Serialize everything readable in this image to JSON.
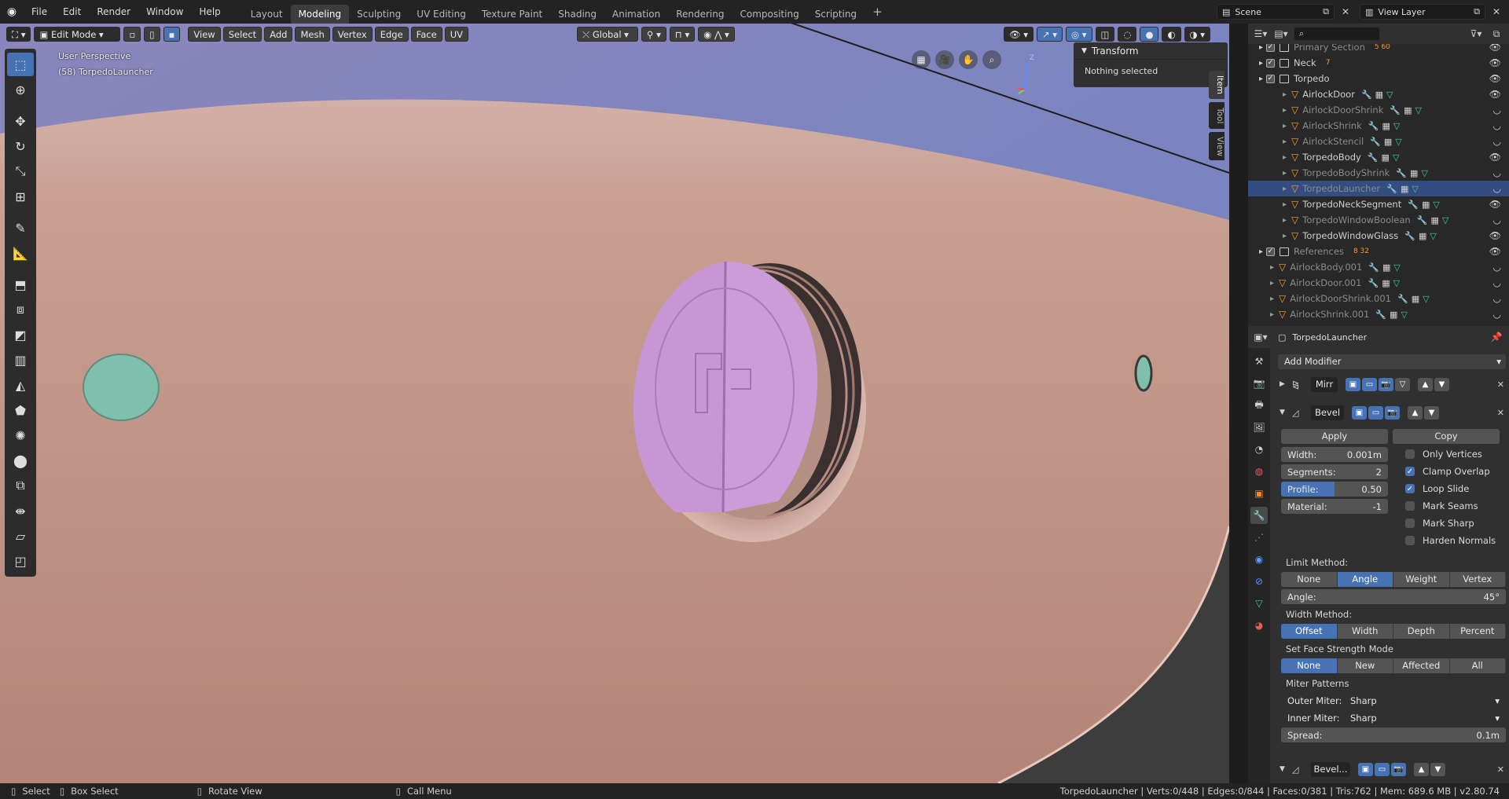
{
  "topbar": {
    "menus": [
      "File",
      "Edit",
      "Render",
      "Window",
      "Help"
    ],
    "workspaces": [
      "Layout",
      "Modeling",
      "Sculpting",
      "UV Editing",
      "Texture Paint",
      "Shading",
      "Animation",
      "Rendering",
      "Compositing",
      "Scripting"
    ],
    "active_workspace": "Modeling",
    "add_tab": "+",
    "scene": "Scene",
    "view_layer": "View Layer"
  },
  "viewport": {
    "mode": "Edit Mode",
    "menus": [
      "View",
      "Select",
      "Add",
      "Mesh",
      "Vertex",
      "Edge",
      "Face",
      "UV"
    ],
    "orientation": "Global",
    "overlay_title": "User Perspective",
    "overlay_object": "(58) TorpedoLauncher",
    "npanel_title": "Transform",
    "npanel_text": "Nothing selected",
    "side_tabs": [
      "Item",
      "Tool",
      "View"
    ],
    "axis_label": "Z"
  },
  "outliner": {
    "rows": [
      {
        "name": "Primary Section",
        "dim": true,
        "kind": "collection",
        "indent": 1,
        "counts": "5  60"
      },
      {
        "name": "Neck",
        "dim": false,
        "kind": "collection",
        "indent": 1,
        "counts": "7"
      },
      {
        "name": "Torpedo",
        "dim": false,
        "kind": "collection",
        "indent": 1,
        "counts": ""
      },
      {
        "name": "AirlockDoor",
        "dim": false,
        "kind": "object",
        "indent": 2,
        "visible": true
      },
      {
        "name": "AirlockDoorShrink",
        "dim": true,
        "kind": "object",
        "indent": 2,
        "visible": false
      },
      {
        "name": "AirlockShrink",
        "dim": true,
        "kind": "object",
        "indent": 2,
        "visible": false
      },
      {
        "name": "AirlockStencil",
        "dim": true,
        "kind": "object",
        "indent": 2,
        "visible": false
      },
      {
        "name": "TorpedoBody",
        "dim": false,
        "kind": "object",
        "indent": 2,
        "visible": true
      },
      {
        "name": "TorpedoBodyShrink",
        "dim": true,
        "kind": "object",
        "indent": 2,
        "visible": false
      },
      {
        "name": "TorpedoLauncher",
        "dim": true,
        "kind": "object",
        "indent": 2,
        "visible": false,
        "selected": true
      },
      {
        "name": "TorpedoNeckSegment",
        "dim": false,
        "kind": "object",
        "indent": 2,
        "visible": true
      },
      {
        "name": "TorpedoWindowBoolean",
        "dim": true,
        "kind": "object",
        "indent": 2,
        "visible": false
      },
      {
        "name": "TorpedoWindowGlass",
        "dim": false,
        "kind": "object",
        "indent": 2,
        "visible": true
      },
      {
        "name": "References",
        "dim": true,
        "kind": "collection",
        "indent": 1,
        "counts": "8  32"
      },
      {
        "name": "AirlockBody.001",
        "dim": true,
        "kind": "object",
        "indent": 1,
        "visible": false
      },
      {
        "name": "AirlockDoor.001",
        "dim": true,
        "kind": "object",
        "indent": 1,
        "visible": false
      },
      {
        "name": "AirlockDoorShrink.001",
        "dim": true,
        "kind": "object",
        "indent": 1,
        "visible": false
      },
      {
        "name": "AirlockShrink.001",
        "dim": true,
        "kind": "object",
        "indent": 1,
        "visible": false
      }
    ]
  },
  "properties": {
    "object_name": "TorpedoLauncher",
    "add_modifier": "Add Modifier",
    "mod1_name": "Mirr",
    "mod2_name": "Bevel",
    "apply": "Apply",
    "copy": "Copy",
    "width_label": "Width:",
    "width_value": "0.001m",
    "segments_label": "Segments:",
    "segments_value": "2",
    "profile_label": "Profile:",
    "profile_value": "0.50",
    "profile_fraction": 0.5,
    "material_label": "Material:",
    "material_value": "-1",
    "checks": [
      {
        "label": "Only Vertices",
        "on": false
      },
      {
        "label": "Clamp Overlap",
        "on": true
      },
      {
        "label": "Loop Slide",
        "on": true
      },
      {
        "label": "Mark Seams",
        "on": false
      },
      {
        "label": "Mark Sharp",
        "on": false
      },
      {
        "label": "Harden Normals",
        "on": false
      }
    ],
    "limit_method_label": "Limit Method:",
    "limit_options": [
      "None",
      "Angle",
      "Weight",
      "Vertex Group"
    ],
    "limit_active": 1,
    "angle_label": "Angle:",
    "angle_value": "45°",
    "width_method_label": "Width Method:",
    "width_options": [
      "Offset",
      "Width",
      "Depth",
      "Percent"
    ],
    "width_active": 0,
    "face_strength_label": "Set Face Strength Mode",
    "face_options": [
      "None",
      "New",
      "Affected",
      "All"
    ],
    "face_active": 0,
    "miter_label": "Miter Patterns",
    "outer_miter_label": "Outer Miter:",
    "outer_miter_value": "Sharp",
    "inner_miter_label": "Inner Miter:",
    "inner_miter_value": "Sharp",
    "spread_label": "Spread:",
    "spread_value": "0.1m",
    "mod3_name": "Bevel..."
  },
  "statusbar": {
    "select": "Select",
    "box_select": "Box Select",
    "rotate": "Rotate View",
    "call_menu": "Call Menu",
    "stats": "TorpedoLauncher | Verts:0/448 | Edges:0/844 | Faces:0/381 | Tris:762 | Mem: 689.6 MB | v2.80.74"
  },
  "colors": {
    "accent": "#4772b3",
    "hull": "#c49a8c",
    "sky": "#7b86b8",
    "hatch": "#c998d6",
    "window": "#7fbfac",
    "selected_row": "#334d80"
  }
}
